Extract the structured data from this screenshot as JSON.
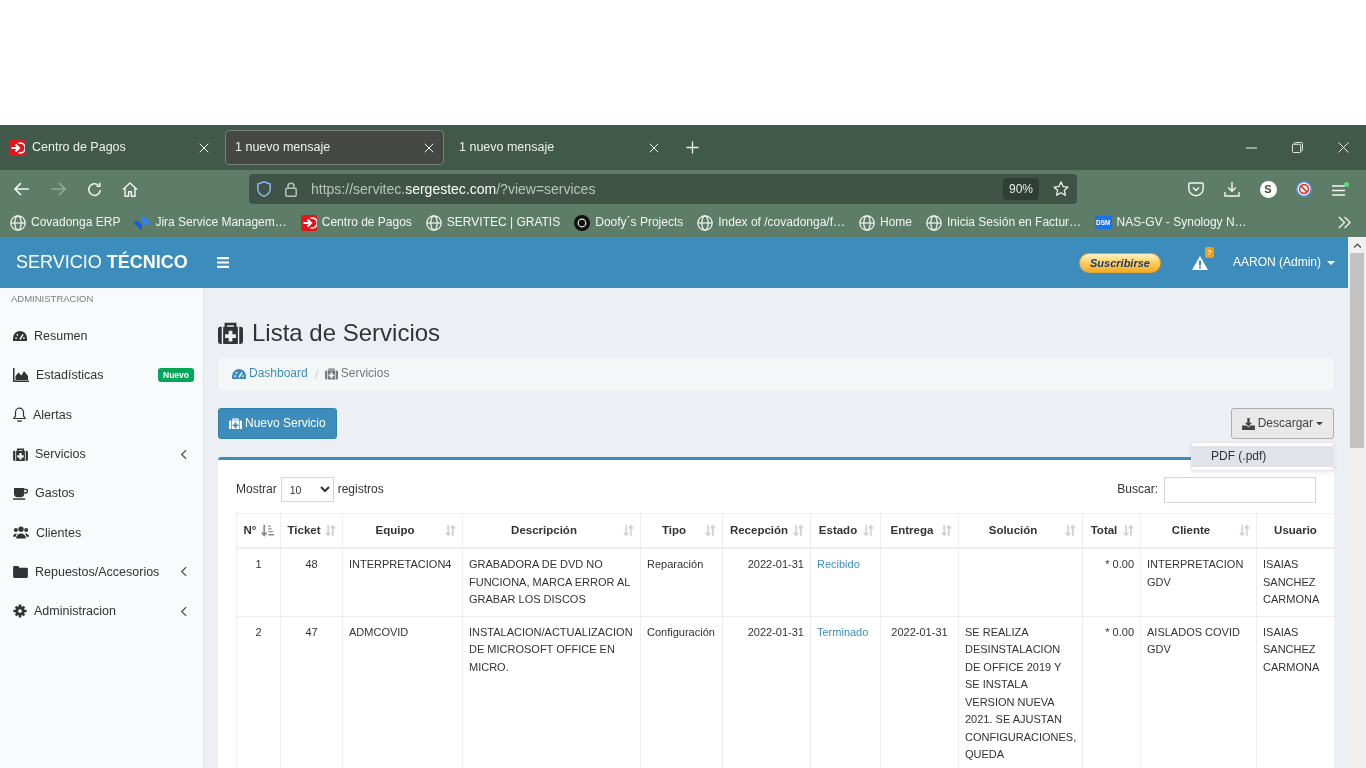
{
  "browser": {
    "tabs": [
      {
        "title": "Centro de Pagos",
        "kind": "pay",
        "selected": false
      },
      {
        "title": "1 nuevo mensaje",
        "selected": true
      },
      {
        "title": "1 nuevo mensaje",
        "selected": false
      }
    ],
    "nav_buttons": [
      {
        "kind": "back",
        "disabled": false
      },
      {
        "kind": "forward",
        "disabled": true
      },
      {
        "kind": "reload",
        "disabled": false
      },
      {
        "kind": "home",
        "disabled": false
      }
    ],
    "address_bar": {
      "url": "https://servitec.**sergestec.com**/?view=services",
      "zoom": "90%"
    },
    "account_initial": "S",
    "bookmarks": [
      {
        "label": "Covadonga ERP",
        "kind": "globe"
      },
      {
        "label": "Jira Service Managem…",
        "kind": "jira"
      },
      {
        "label": "Centro de Pagos",
        "kind": "pay"
      },
      {
        "label": "SERVITEC | GRATIS",
        "kind": "globe"
      },
      {
        "label": "Doofy´s Projects",
        "kind": "doofy"
      },
      {
        "label": "Index of /covadonga/f…",
        "kind": "globe"
      },
      {
        "label": "Home",
        "kind": "globe"
      },
      {
        "label": "Inicia Sesión en Factur…",
        "kind": "globe"
      },
      {
        "label": "NAS-GV - Synology N…",
        "kind": "dsm",
        "favicon_text": "DSM"
      }
    ]
  },
  "header": {
    "brand": "SERVICIO **TÉCNICO**",
    "subscribe_button": "Suscribirse",
    "alerts_badge": "?",
    "user_menu": "AARON (Admin)"
  },
  "sidebar": {
    "heading": "ADMINISTRACION",
    "items": [
      {
        "label": "Resumen",
        "kind": "dashboard",
        "submenu": false
      },
      {
        "label": "Estadísticas",
        "kind": "area-chart",
        "badge": "Nuevo",
        "submenu": false
      },
      {
        "label": "Alertas",
        "kind": "bell",
        "submenu": false
      },
      {
        "label": "Servicios",
        "kind": "medkit",
        "submenu": true
      },
      {
        "label": "Gastos",
        "kind": "coffee",
        "submenu": false
      },
      {
        "label": "Clientes",
        "kind": "users",
        "submenu": false
      },
      {
        "label": "Repuestos/Accesorios",
        "kind": "folder",
        "submenu": true
      },
      {
        "label": "Administracion",
        "kind": "cog",
        "submenu": true
      }
    ]
  },
  "page": {
    "title": "Lista de Servicios",
    "breadcrumb": [
      {
        "label": "Dashboard",
        "kind": "dashboard",
        "link": true
      },
      {
        "label": "Servicios",
        "kind": "medkit",
        "link": false
      }
    ],
    "new_button": "Nuevo Servicio",
    "download_button": {
      "label": "Descargar",
      "expanded": true,
      "menu": [
        {
          "label": "PDF (.pdf)",
          "selected": true
        }
      ]
    },
    "table": {
      "length_prefix": "Mostrar",
      "length_value": "10",
      "length_suffix": "registros",
      "search_label": "Buscar:",
      "columns": [
        {
          "label": "N°",
          "sorted": true
        },
        {
          "label": "Ticket",
          "sorted": false
        },
        {
          "label": "Equipo",
          "sorted": false
        },
        {
          "label": "Descripción",
          "sorted": false
        },
        {
          "label": "Tipo",
          "sorted": false
        },
        {
          "label": "Recepción",
          "sorted": false
        },
        {
          "label": "Estado",
          "sorted": false
        },
        {
          "label": "Entrega",
          "sorted": false
        },
        {
          "label": "Solución",
          "sorted": false
        },
        {
          "label": "Total",
          "sorted": false
        },
        {
          "label": "Cliente",
          "sorted": false
        },
        {
          "label": "Usuario"
        }
      ],
      "rows": [
        {
          "number": "1",
          "ticket": "48",
          "equipment": "INTERPRETACION4",
          "description": "GRABADORA DE DVD NO FUNCIONA, MARCA ERROR AL GRABAR LOS DISCOS",
          "type": "Reparación",
          "received": "2022-01-31",
          "status": "Recibido",
          "total": "* 0.00",
          "client": "INTERPRETACION GDV",
          "user": "ISAIAS SANCHEZ CARMONA"
        },
        {
          "number": "2",
          "ticket": "47",
          "equipment": "ADMCOVID",
          "description": "INSTALACION/ACTUALIZACION DE MICROSOFT OFFICE EN MICRO.",
          "type": "Configuración",
          "received": "2022-01-31",
          "status": "Terminado",
          "delivered": "2022-01-31",
          "solution": "SE REALIZA DESINSTALACION DE OFFICE 2019 Y SE INSTALA VERSION NUEVA 2021. SE AJUSTAN CONFIGURACIONES, QUEDA",
          "total": "* 0.00",
          "client": "AISLADOS COVID GDV",
          "user": "ISAIAS SANCHEZ CARMONA"
        }
      ]
    }
  }
}
